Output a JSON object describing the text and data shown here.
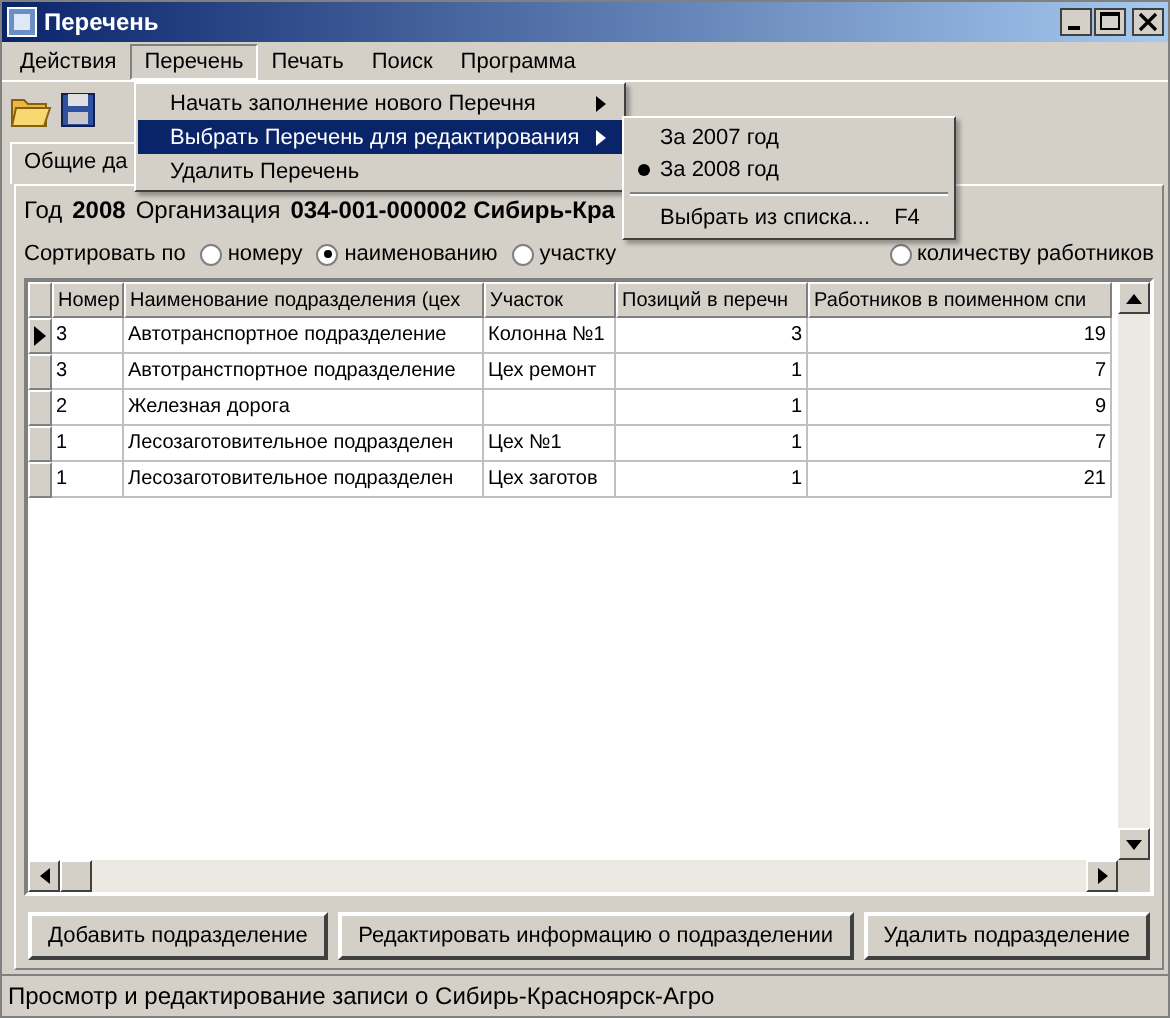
{
  "window": {
    "title": "Перечень"
  },
  "menubar": [
    {
      "label": "Действия",
      "selected": false
    },
    {
      "label": "Перечень",
      "selected": true
    },
    {
      "label": "Печать",
      "selected": false
    },
    {
      "label": "Поиск",
      "selected": false
    },
    {
      "label": "Программа",
      "selected": false
    }
  ],
  "menu": [
    {
      "label": "Начать заполнение нового Перечня",
      "has_submenu": true,
      "selected": false
    },
    {
      "label": "Выбрать Перечень для редактирования",
      "has_submenu": true,
      "selected": true
    },
    {
      "label": "Удалить Перечень",
      "has_submenu": false,
      "selected": false
    }
  ],
  "submenu": [
    {
      "kind": "radio",
      "label": "За 2007 год",
      "checked": false
    },
    {
      "kind": "radio",
      "label": "За 2008 год",
      "checked": true
    },
    {
      "kind": "separator"
    },
    {
      "kind": "command",
      "label": "Выбрать из списка...",
      "shortcut": "F4"
    }
  ],
  "tabs": [
    {
      "label": "Общие да",
      "selected": true
    }
  ],
  "info": {
    "year_label": "Год",
    "year": "2008",
    "org_label": "Организация",
    "org": "034-001-000002 Сибирь-Кра"
  },
  "sort": {
    "label": "Сортировать по",
    "options": [
      {
        "label": "номеру",
        "selected": false
      },
      {
        "label": "наименованию",
        "selected": true
      },
      {
        "label": "участку",
        "selected": false
      },
      {
        "label": "количеству работников",
        "selected": false
      }
    ]
  },
  "table": {
    "columns": [
      "Номер",
      "Наименование подразделения (цех",
      "Участок",
      "Позиций в перечн",
      "Работников в поименном спи"
    ],
    "rows": [
      {
        "current": true,
        "cells": [
          "3",
          "Автотранспортное подразделение",
          "Колонна №1",
          "3",
          "19"
        ]
      },
      {
        "current": false,
        "cells": [
          "3",
          "Автотранстпортное подразделение",
          "Цех ремонт",
          "1",
          "7"
        ]
      },
      {
        "current": false,
        "cells": [
          "2",
          "Железная дорога",
          "",
          "1",
          "9"
        ]
      },
      {
        "current": false,
        "cells": [
          "1",
          "Лесозаготовительное подразделен",
          "Цех №1",
          "1",
          "7"
        ]
      },
      {
        "current": false,
        "cells": [
          "1",
          "Лесозаготовительное подразделен",
          "Цех заготов",
          "1",
          "21"
        ]
      }
    ]
  },
  "buttons": [
    "Добавить подразделение",
    "Редактировать информацию о подразделении",
    "Удалить подразделение"
  ],
  "status_bar": "Просмотр и редактирование записи о Сибирь-Красноярск-Агро"
}
